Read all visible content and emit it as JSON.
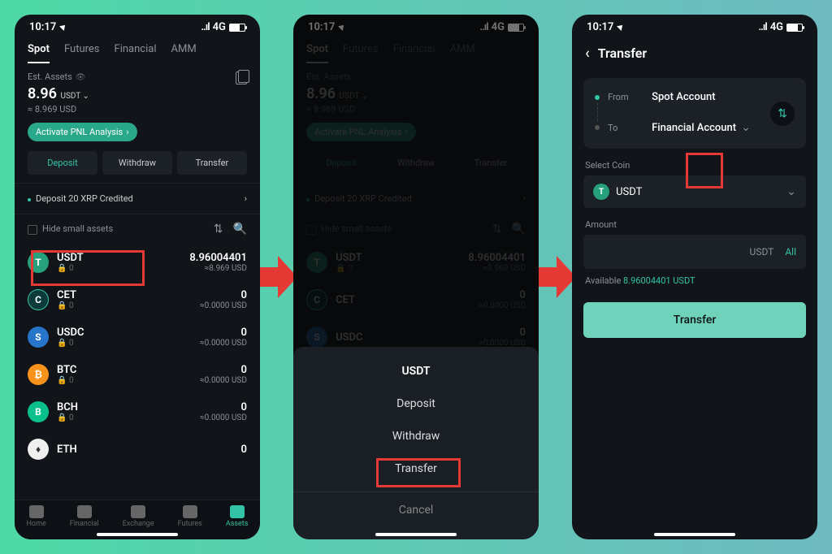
{
  "status": {
    "time": "10:17",
    "net": "4G",
    "signal": "..ıl"
  },
  "tabs": [
    "Spot",
    "Futures",
    "Financial",
    "AMM"
  ],
  "est_label": "Est. Assets",
  "balance_value": "8.96",
  "balance_unit": "USDT",
  "approx": "≈ 8.969 USD",
  "pnl": "Activate PNL Analysis",
  "actions": {
    "deposit": "Deposit",
    "withdraw": "Withdraw",
    "transfer": "Transfer"
  },
  "credit_notice": "Deposit 20 XRP Credited",
  "hide_small": "Hide small assets",
  "assets": [
    {
      "sym": "USDT",
      "cls": "usdt",
      "letter": "T",
      "lock": "0",
      "val": "8.96004401",
      "approx": "≈8.969 USD"
    },
    {
      "sym": "CET",
      "cls": "cet",
      "letter": "C",
      "lock": "0",
      "val": "0",
      "approx": "≈0.0000 USD"
    },
    {
      "sym": "USDC",
      "cls": "usdc",
      "letter": "S",
      "lock": "0",
      "val": "0",
      "approx": "≈0.0000 USD"
    },
    {
      "sym": "BTC",
      "cls": "btc",
      "letter": "₿",
      "lock": "0",
      "val": "0",
      "approx": "≈0.0000 USD"
    },
    {
      "sym": "BCH",
      "cls": "bch",
      "letter": "B",
      "lock": "0",
      "val": "0",
      "approx": "≈0.0000 USD"
    },
    {
      "sym": "ETH",
      "cls": "eth",
      "letter": "♦",
      "lock": "",
      "val": "0",
      "approx": ""
    }
  ],
  "nav": [
    "Home",
    "Financial",
    "Exchange",
    "Futures",
    "Assets"
  ],
  "sheet": {
    "title": "USDT",
    "items": [
      "Deposit",
      "Withdraw",
      "Transfer"
    ],
    "cancel": "Cancel"
  },
  "transfer": {
    "title": "Transfer",
    "from_label": "From",
    "from": "Spot Account",
    "to_label": "To",
    "to": "Financial Account",
    "select_coin_label": "Select Coin",
    "coin": "USDT",
    "amount_label": "Amount",
    "unit": "USDT",
    "all": "All",
    "available_label": "Available",
    "available_value": "8.96004401 USDT",
    "button": "Transfer"
  }
}
